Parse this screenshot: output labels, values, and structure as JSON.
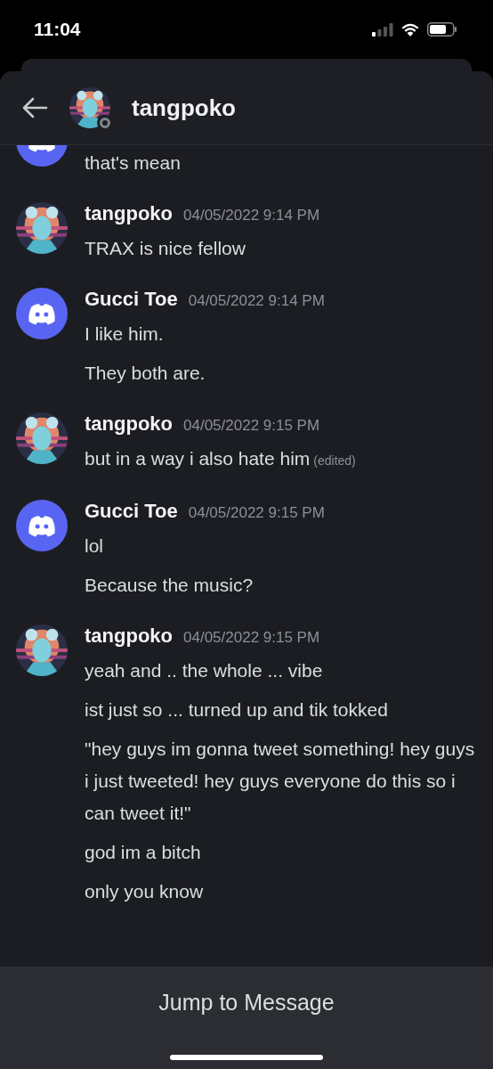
{
  "status_bar": {
    "time": "11:04"
  },
  "header": {
    "title": "tangpoko",
    "avatar": {
      "kind": "picture"
    },
    "online": false
  },
  "messages": [
    {
      "avatar": {
        "kind": "discord"
      },
      "lines": [
        {
          "text": "that's mean"
        }
      ]
    },
    {
      "avatar": {
        "kind": "picture"
      },
      "author": "tangpoko",
      "time": "04/05/2022 9:14 PM",
      "lines": [
        {
          "text": "TRAX is nice fellow"
        }
      ]
    },
    {
      "avatar": {
        "kind": "discord"
      },
      "author": "Gucci Toe",
      "time": "04/05/2022 9:14 PM",
      "lines": [
        {
          "text": "I like him."
        },
        {
          "text": "They both are."
        }
      ]
    },
    {
      "avatar": {
        "kind": "picture"
      },
      "author": "tangpoko",
      "time": "04/05/2022 9:15 PM",
      "lines": [
        {
          "text": "but in a way i also hate him",
          "edited_label": "(edited)"
        }
      ]
    },
    {
      "avatar": {
        "kind": "discord"
      },
      "author": "Gucci Toe",
      "time": "04/05/2022 9:15 PM",
      "lines": [
        {
          "text": "lol"
        },
        {
          "text": "Because the music?"
        }
      ]
    },
    {
      "avatar": {
        "kind": "picture"
      },
      "author": "tangpoko",
      "time": "04/05/2022 9:15 PM",
      "lines": [
        {
          "text": "yeah and .. the whole ... vibe"
        },
        {
          "text": "ist just so ... turned up and tik tokked"
        },
        {
          "text": "\"hey guys im gonna tweet something! hey guys i just tweeted! hey guys everyone do this so i can tweet it!\""
        },
        {
          "text": "god im a bitch"
        },
        {
          "text": "only you know"
        }
      ]
    }
  ],
  "footer": {
    "button": "Jump to Message"
  }
}
